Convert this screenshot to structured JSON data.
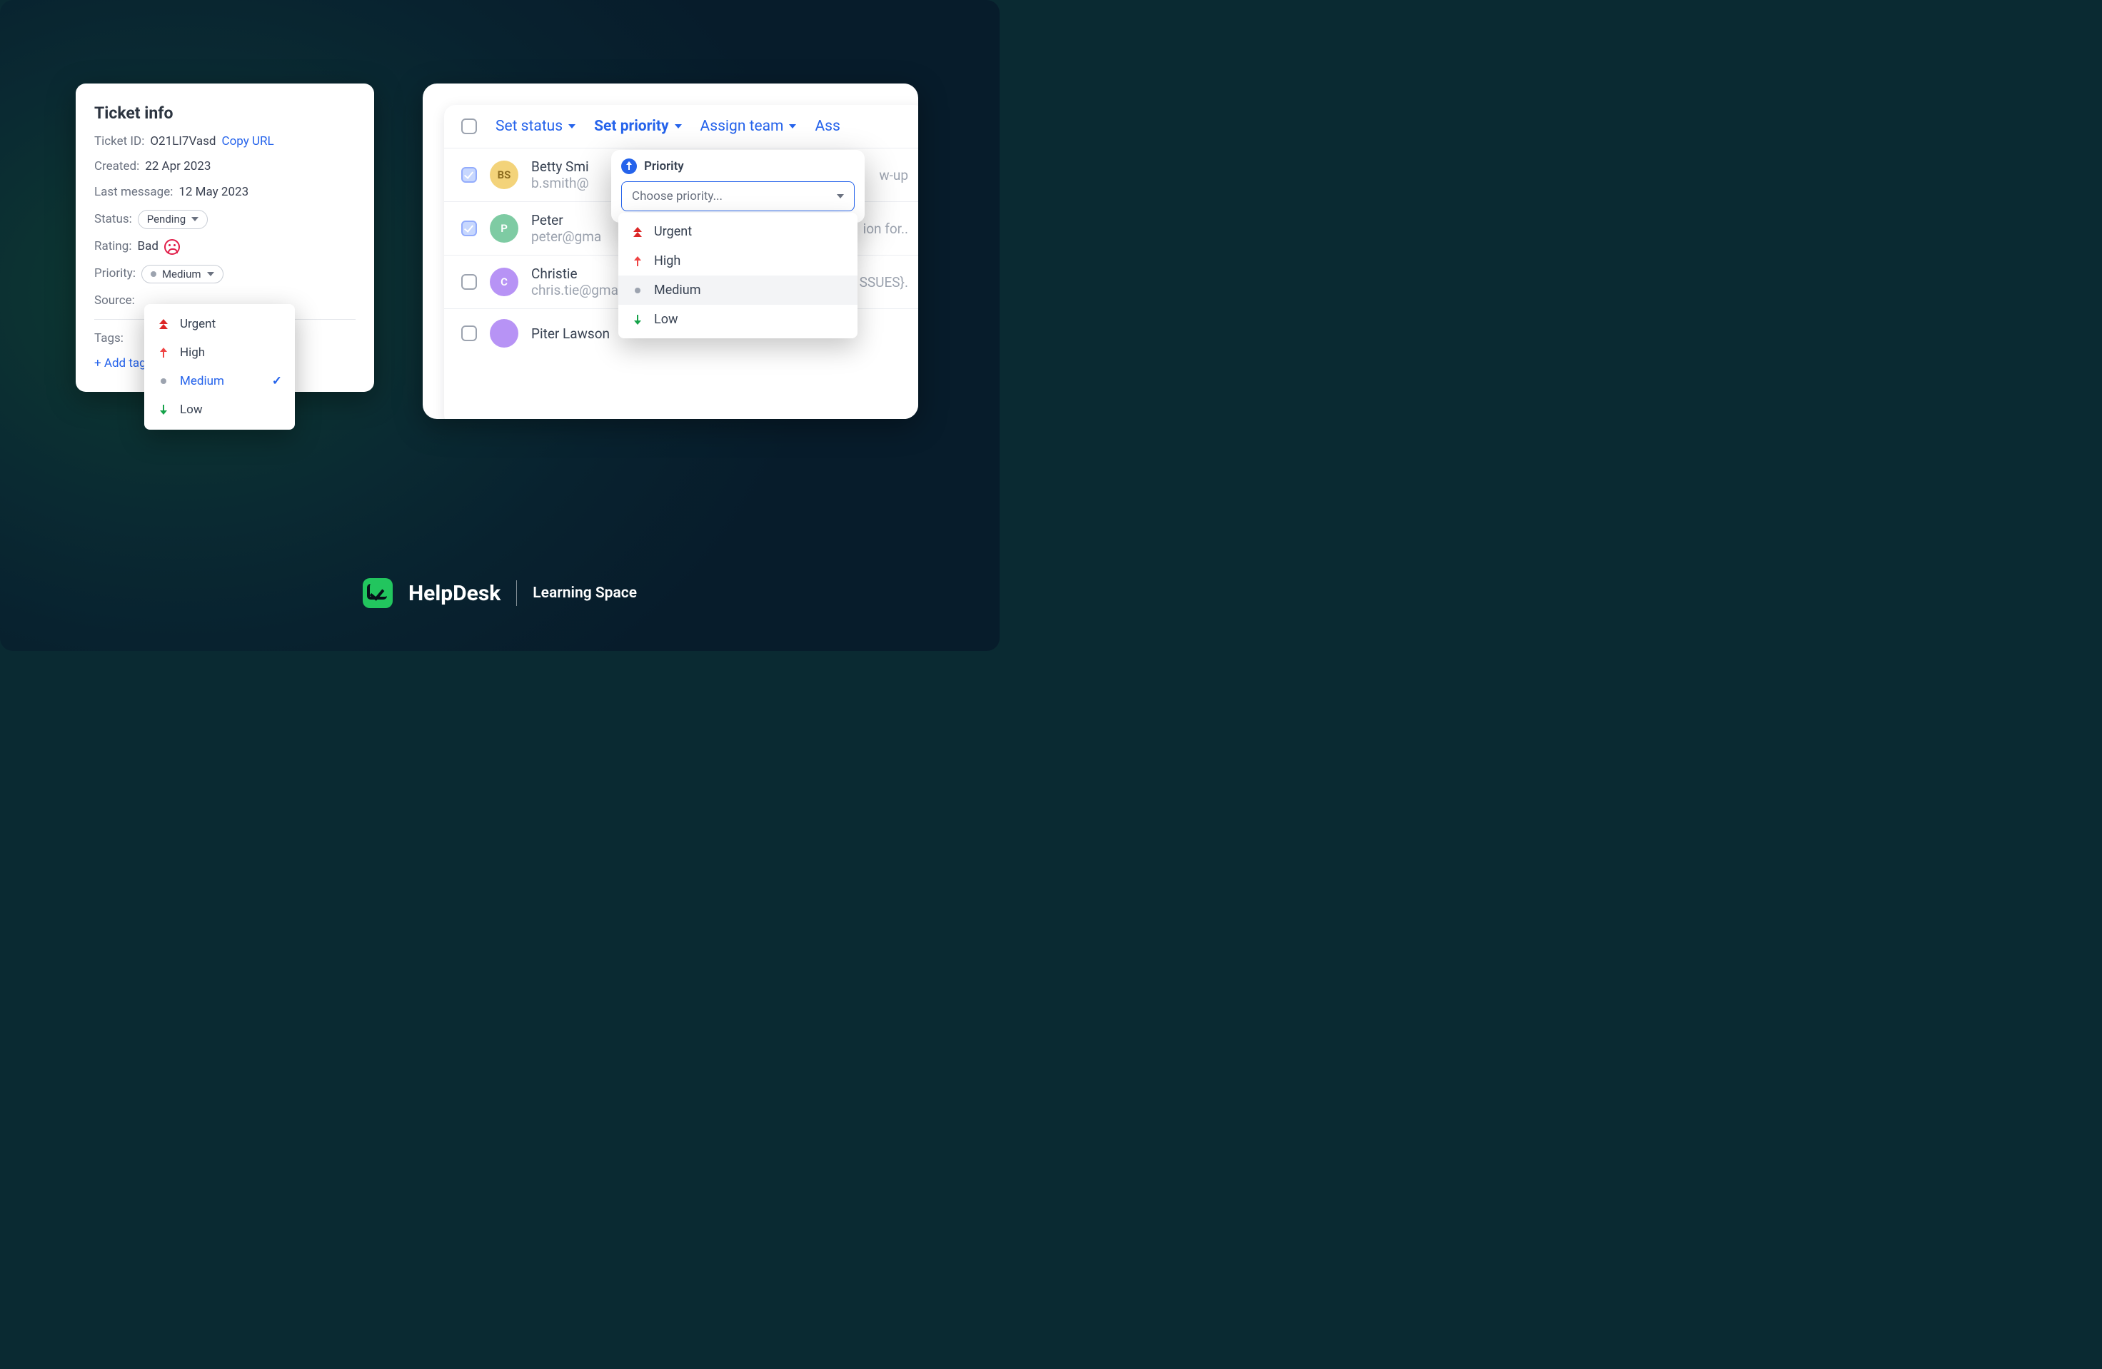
{
  "ticket_panel": {
    "title": "Ticket info",
    "labels": {
      "ticket_id": "Ticket ID:",
      "created": "Created:",
      "last_message": "Last message:",
      "status": "Status:",
      "rating": "Rating:",
      "priority": "Priority:",
      "source": "Source:",
      "tags": "Tags:"
    },
    "values": {
      "ticket_id": "O21LI7Vasd",
      "copy_url": "Copy URL",
      "created": "22 Apr 2023",
      "last_message": "12 May 2023",
      "status": "Pending",
      "rating": "Bad",
      "priority": "Medium",
      "add_tag": "+ Add tag"
    },
    "priority_options": [
      {
        "label": "Urgent",
        "level": "urgent",
        "selected": false
      },
      {
        "label": "High",
        "level": "high",
        "selected": false
      },
      {
        "label": "Medium",
        "level": "medium",
        "selected": true
      },
      {
        "label": "Low",
        "level": "low",
        "selected": false
      }
    ]
  },
  "list_panel": {
    "toolbar": {
      "set_status": "Set status",
      "set_priority": "Set priority",
      "assign_team": "Assign team",
      "assign_more": "Ass"
    },
    "popover": {
      "title": "Priority",
      "placeholder": "Choose priority...",
      "options": [
        {
          "label": "Urgent",
          "level": "urgent",
          "hover": false
        },
        {
          "label": "High",
          "level": "high",
          "hover": false
        },
        {
          "label": "Medium",
          "level": "medium",
          "hover": true
        },
        {
          "label": "Low",
          "level": "low",
          "hover": false
        }
      ]
    },
    "rows": [
      {
        "checked": true,
        "avatar_class": "av-yellow",
        "initials": "BS",
        "name": "Betty Smi",
        "email": "b.smith@",
        "rest": "w-up"
      },
      {
        "checked": true,
        "avatar_class": "av-green",
        "initials": "P",
        "name": "Peter",
        "email": "peter@gma",
        "rest": "ion for.."
      },
      {
        "checked": false,
        "avatar_class": "av-purple",
        "initials": "C",
        "name": "Christie",
        "email": "chris.tie@gmail.com",
        "rest": "SSUES}."
      },
      {
        "checked": false,
        "avatar_class": "av-purple",
        "initials": "",
        "name": "Piter Lawson",
        "email": "",
        "rest": ""
      }
    ]
  },
  "footer": {
    "brand": "HelpDesk",
    "subtitle": "Learning Space"
  }
}
